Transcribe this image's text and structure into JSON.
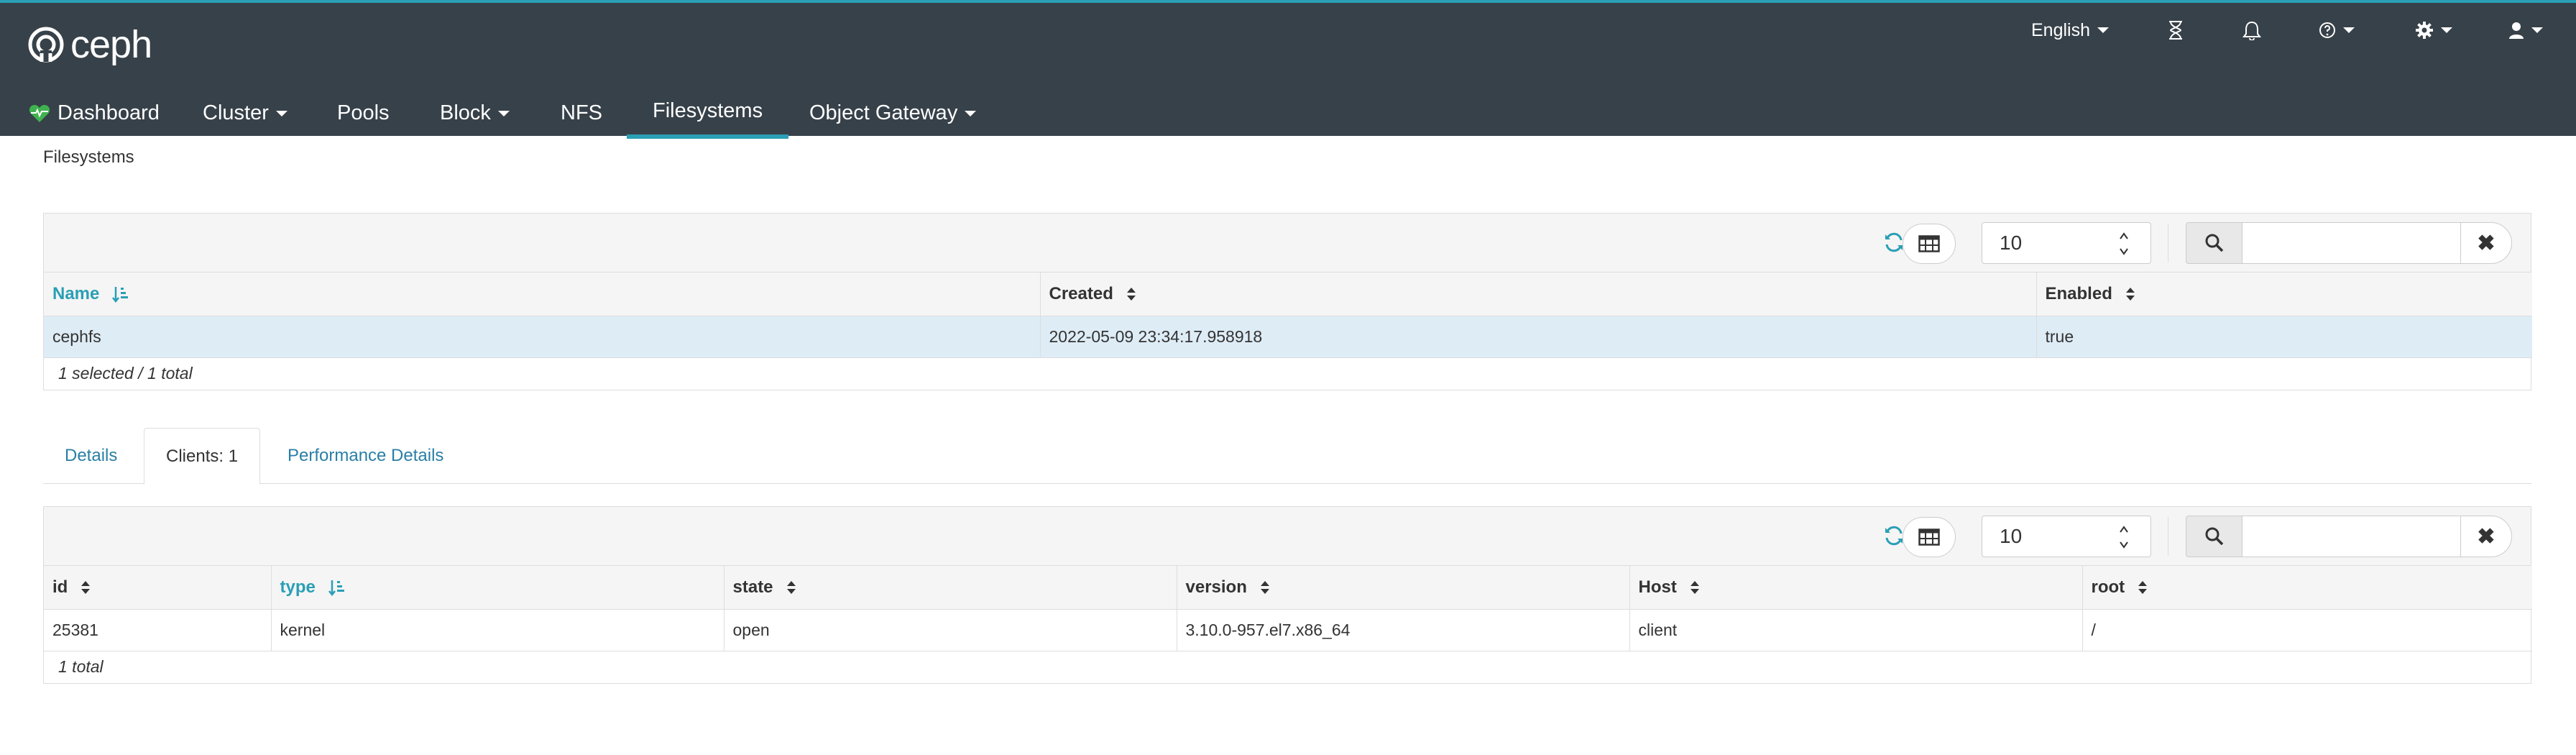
{
  "brand": {
    "name": "ceph"
  },
  "header": {
    "language": "English",
    "icons": [
      "hourglass-icon",
      "bell-icon",
      "help-icon",
      "gear-icon",
      "user-icon"
    ]
  },
  "nav": {
    "dashboard": "Dashboard",
    "cluster": "Cluster",
    "pools": "Pools",
    "block": "Block",
    "nfs": "NFS",
    "filesystems": "Filesystems",
    "object_gateway": "Object Gateway"
  },
  "breadcrumb": "Filesystems",
  "fs_table": {
    "limit": "10",
    "search_value": "",
    "columns": [
      "Name",
      "Created",
      "Enabled"
    ],
    "rows": [
      {
        "name": "cephfs",
        "created": "2022-05-09 23:34:17.958918",
        "enabled": "true"
      }
    ],
    "footer": "1 selected / 1 total"
  },
  "tabs": {
    "details": "Details",
    "clients": "Clients: 1",
    "performance": "Performance Details"
  },
  "clients_table": {
    "limit": "10",
    "search_value": "",
    "columns": [
      "id",
      "type",
      "state",
      "version",
      "Host",
      "root"
    ],
    "rows": [
      {
        "id": "25381",
        "type": "kernel",
        "state": "open",
        "version": "3.10.0-957.el7.x86_64",
        "host": "client",
        "root": "/"
      }
    ],
    "footer": "1 total"
  },
  "colors": {
    "accent": "#2a9fb5",
    "topbar": "#374149",
    "selected_row": "#deecf6",
    "link": "#2a7fa5"
  }
}
